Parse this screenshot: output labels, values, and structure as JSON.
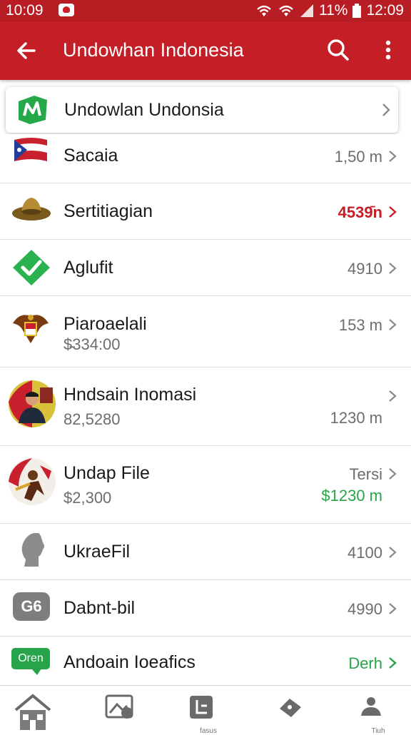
{
  "status_bar": {
    "time_left": "10:09",
    "battery": "11%",
    "time_right": "12:09"
  },
  "app_bar": {
    "title": "Undowhan Indonesia"
  },
  "featured": {
    "label": "Undowlan Undonsia"
  },
  "rows": [
    {
      "name": "Sacaia",
      "value": "1,50 m",
      "icon": "flag-icon"
    },
    {
      "name": "Sertitiagian",
      "value": "4539̄n",
      "value_color": "#c51e27",
      "icon": "hat-icon"
    },
    {
      "name": "Aglufit",
      "value": "4910",
      "icon": "check-diamond-icon"
    },
    {
      "name": "Piaroaelali",
      "sub": "$̵334:00",
      "value": "153 m",
      "icon": "emblem-icon"
    },
    {
      "name": "Hndsain Inomasi",
      "sub": "82,5280",
      "value": "1230 m",
      "icon": "portrait-icon"
    },
    {
      "name": "Undap File",
      "sub": "$2,300",
      "value": "Tersi",
      "value2": "$1230 m",
      "value2_color": "#27a34a",
      "icon": "dancer-icon"
    },
    {
      "name": "UkraeFil",
      "value": "4100",
      "icon": "head-silhouette-icon"
    },
    {
      "name": "Dabnt-bil",
      "value": "4990",
      "icon": "g6-badge-icon",
      "badge": "G6"
    },
    {
      "name": "Andoain Ioeafics",
      "value": "Derh",
      "value_color": "#27a34a",
      "icon": "chat-badge-icon",
      "badge": "Oren"
    }
  ],
  "bottom_nav": [
    {
      "icon": "home-icon"
    },
    {
      "icon": "image-icon"
    },
    {
      "icon": "document-icon",
      "caption": "fasus"
    },
    {
      "icon": "tag-icon"
    },
    {
      "icon": "person-icon",
      "caption": "Tiuh"
    }
  ],
  "colors": {
    "primary": "#c41f27",
    "accent_green": "#27a34a"
  }
}
